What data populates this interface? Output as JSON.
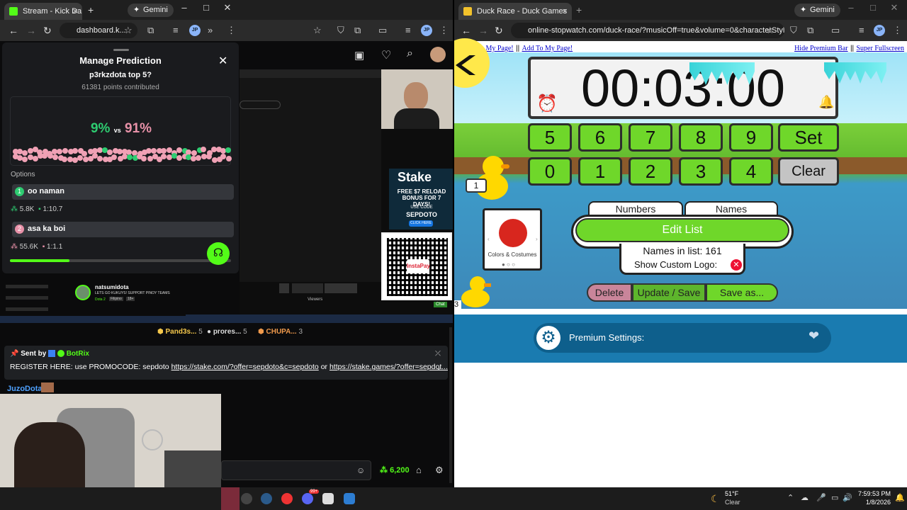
{
  "left_browser": {
    "tab_title": "Stream - Kick Da",
    "gemini_label": "Gemini",
    "url": "dashboard.k...",
    "profile": "JP"
  },
  "prediction": {
    "title": "Manage Prediction",
    "question": "p3rkzdota top 5?",
    "points": "61381 points contributed",
    "left_pct": "9%",
    "vs": "vs",
    "right_pct": "91%",
    "left_pct_value": 9,
    "options_label": "Options",
    "options": [
      {
        "index": "1",
        "label": "oo naman",
        "count": "5.8K",
        "ratio": "1:10.7",
        "color": "#2ecc71"
      },
      {
        "index": "2",
        "label": "asa ka boi",
        "count": "55.6K",
        "ratio": "1:1.1",
        "color": "#e891a8"
      }
    ],
    "progress": 0.27
  },
  "stream": {
    "streamer_name": "natsumidota",
    "streamer_msg": "LETS GO KUKUYS! SUPPORT PINOY TEAMS",
    "game": "Dota 2",
    "lang": "Filipino",
    "age": "18+",
    "viewers_label": "Viewers",
    "chat_label": "Chat",
    "stake_brand": "Stake",
    "stake_promo": "FREE $7 RELOAD BONUS FOR 7 DAYS!",
    "stake_code_label": "USE CODE",
    "stake_code": "SEPDOTO",
    "stake_click": "CLICK HERE",
    "qr_label": "InstaPay"
  },
  "leaderboard": [
    {
      "name": "Pand3s...",
      "count": "5"
    },
    {
      "name": "prores...",
      "count": "5"
    },
    {
      "name": "CHUPA...",
      "count": "3"
    }
  ],
  "chat": {
    "pinned_sender_prefix": "Sent by",
    "pinned_sender": "BotRix",
    "pinned_text": "REGISTER HERE: use PROMOCODE: sepdoto",
    "pinned_link1": "https://stake.com/?offer=sepdoto&c=sepdoto",
    "pinned_or": "or",
    "pinned_link2": "https://stake.games/?offer=sepdot...",
    "user1": "JuzoDota:",
    "points_balance": "6,200"
  },
  "right_browser": {
    "tab_title": "Duck Race - Duck Games",
    "gemini_label": "Gemini",
    "url": "online-stopwatch.com/duck-race/?musicOff=true&volume=0&characterStyle...",
    "profile": "JP"
  },
  "page": {
    "back_link": "< Back to My Page!",
    "sep": "||",
    "add_link": "Add To My Page!",
    "hide_link": "Hide Premium Bar",
    "fullscreen_link": "Super Fullscreen",
    "timer": "00:03:00",
    "keys_row1": [
      "5",
      "6",
      "7",
      "8",
      "9"
    ],
    "keys_row2": [
      "0",
      "1",
      "2",
      "3",
      "4"
    ],
    "set_label": "Set",
    "clear_label": "Clear",
    "duck1_label": "1",
    "duck3_label": "3",
    "costume_label": "Colors & Costumes",
    "tab_numbers": "Numbers",
    "tab_names": "Names",
    "edit_list": "Edit List",
    "names_count": "Names in list: 161",
    "custom_logo": "Show Custom Logo:",
    "delete": "Delete",
    "update": "Update / Save",
    "save_as": "Save as...",
    "premium": "Premium Settings:"
  },
  "taskbar": {
    "weather_temp": "51°F",
    "weather_desc": "Clear",
    "time": "7:59:53 PM",
    "date": "1/8/2026",
    "badge": "99+"
  }
}
